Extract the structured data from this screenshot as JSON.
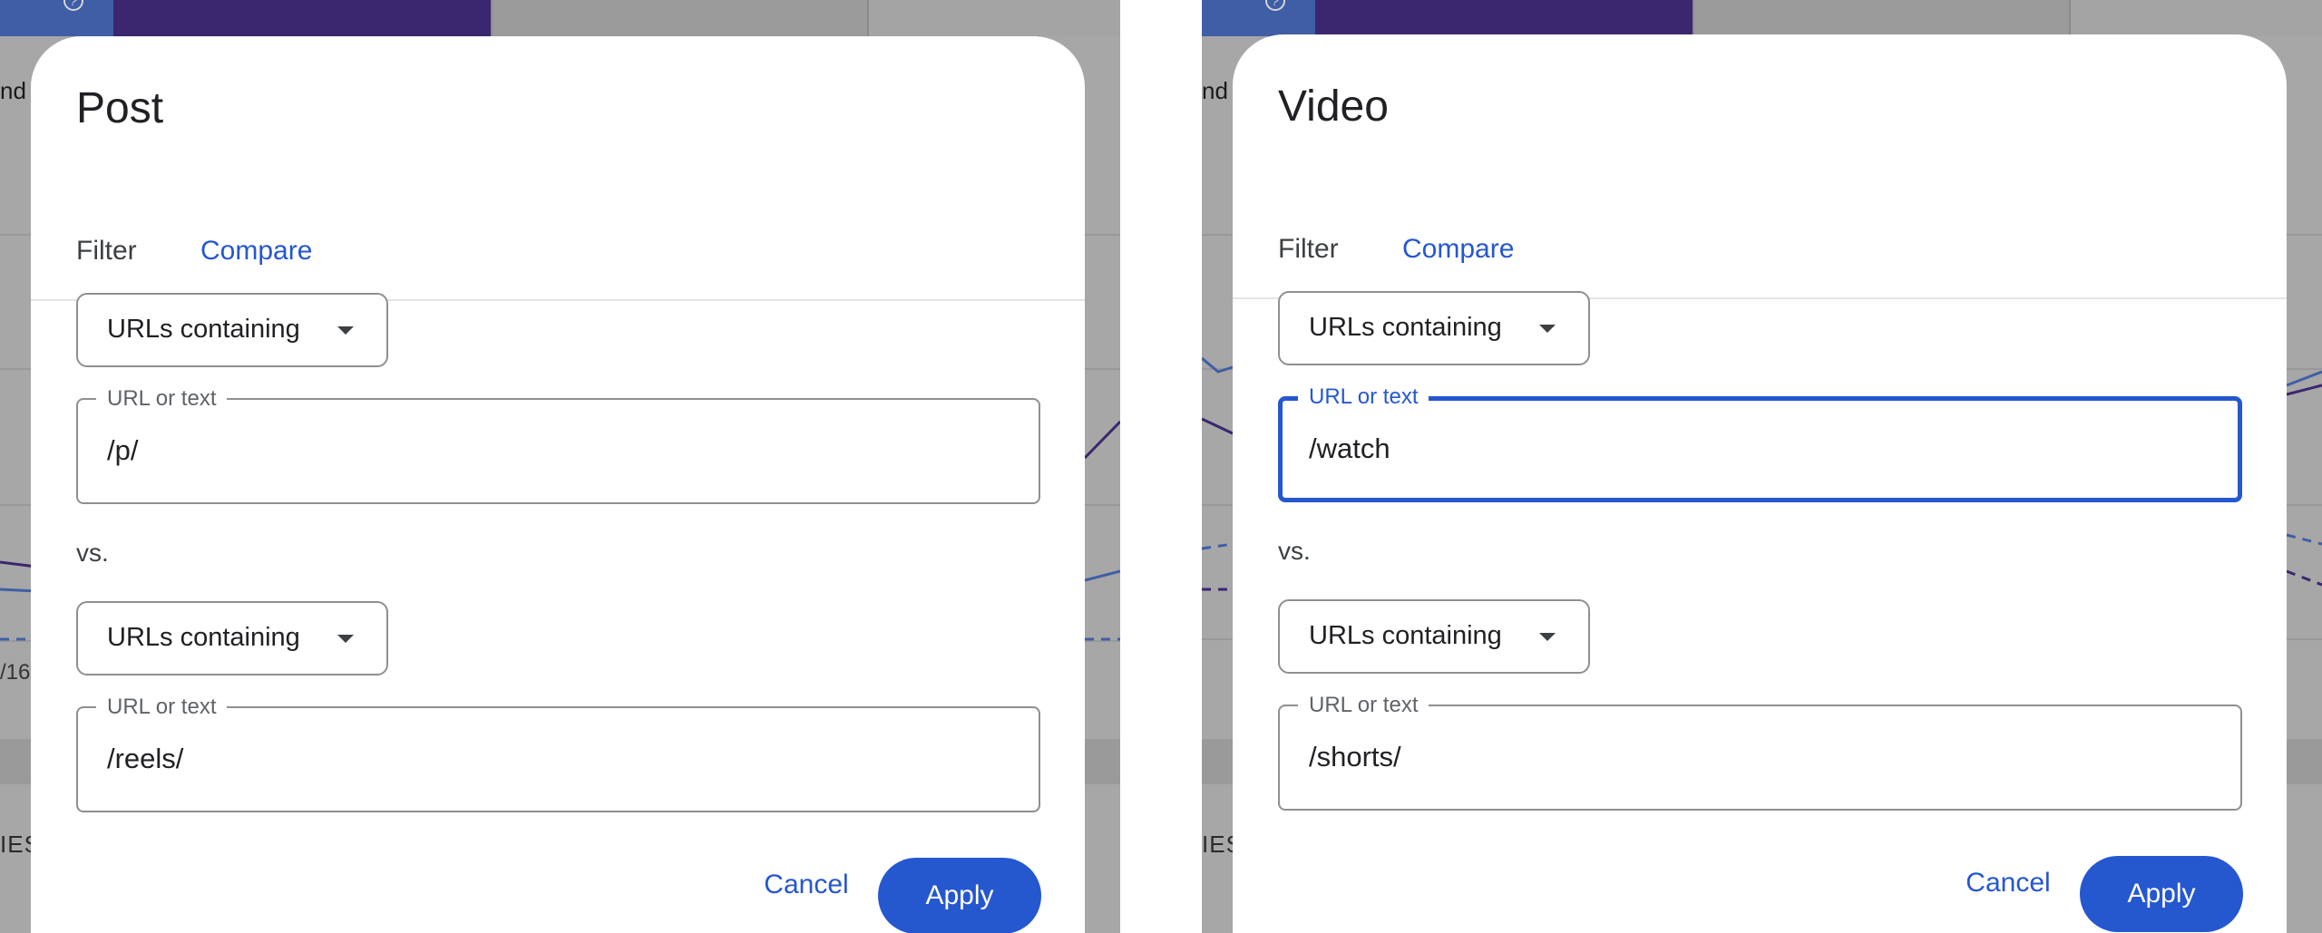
{
  "colors": {
    "accent": "#2557cf",
    "scrim": "#a7a7a7",
    "dialog_bg": "#ffffff"
  },
  "background": {
    "left_snippet": "nd t",
    "right_snippet": "nd t",
    "left_axis_label": "/16",
    "left_series_label": "IES",
    "right_series_label": "IES"
  },
  "dialogs": [
    {
      "title": "Post",
      "tabs": [
        "Filter",
        "Compare"
      ],
      "active_tab": "Compare",
      "first": {
        "dropdown": "URLs containing",
        "field_label": "URL or text",
        "field_value": "/p/",
        "focused": false
      },
      "vs_label": "vs.",
      "second": {
        "dropdown": "URLs containing",
        "field_label": "URL or text",
        "field_value": "/reels/"
      },
      "cancel_label": "Cancel",
      "apply_label": "Apply"
    },
    {
      "title": "Video",
      "tabs": [
        "Filter",
        "Compare"
      ],
      "active_tab": "Compare",
      "first": {
        "dropdown": "URLs containing",
        "field_label": "URL or text",
        "field_value": "/watch",
        "focused": true
      },
      "vs_label": "vs.",
      "second": {
        "dropdown": "URLs containing",
        "field_label": "URL or text",
        "field_value": "/shorts/"
      },
      "cancel_label": "Cancel",
      "apply_label": "Apply"
    }
  ]
}
